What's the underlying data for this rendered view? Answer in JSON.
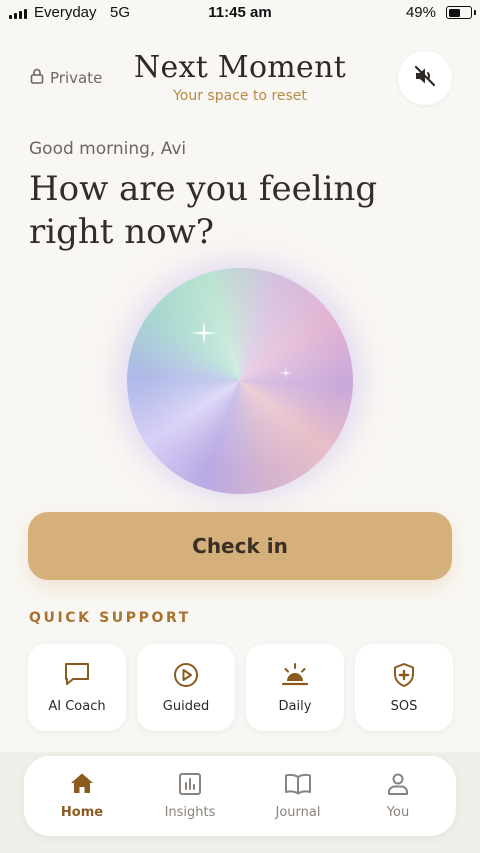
{
  "status_bar": {
    "carrier": "Everyday",
    "network": "5G",
    "time": "11:45 am",
    "battery_percent": "49%",
    "battery_level": 0.49
  },
  "header": {
    "privacy_label": "Private",
    "privacy_icon": "lock-icon",
    "title": "Next Moment",
    "subtitle": "Your space to reset",
    "mute_icon": "speaker-muted-icon"
  },
  "greeting": "Good morning, Avi",
  "prompt": "How are you feeling right now?",
  "checkin_label": "Check in",
  "quick_support": {
    "heading": "QUICK SUPPORT",
    "items": [
      {
        "label": "AI Coach",
        "icon": "chat-bubble-icon"
      },
      {
        "label": "Guided",
        "icon": "play-circle-icon"
      },
      {
        "label": "Daily",
        "icon": "sunrise-icon"
      },
      {
        "label": "SOS",
        "icon": "shield-plus-icon"
      }
    ]
  },
  "tabs": [
    {
      "label": "Home",
      "icon": "home-icon",
      "active": true
    },
    {
      "label": "Insights",
      "icon": "bar-chart-icon",
      "active": false
    },
    {
      "label": "Journal",
      "icon": "book-icon",
      "active": false
    },
    {
      "label": "You",
      "icon": "person-icon",
      "active": false
    }
  ],
  "colors": {
    "background": "#f9f7f3",
    "accent": "#d5b07a",
    "accent_text": "#a8722f",
    "active_tab": "#8a5a1f"
  }
}
